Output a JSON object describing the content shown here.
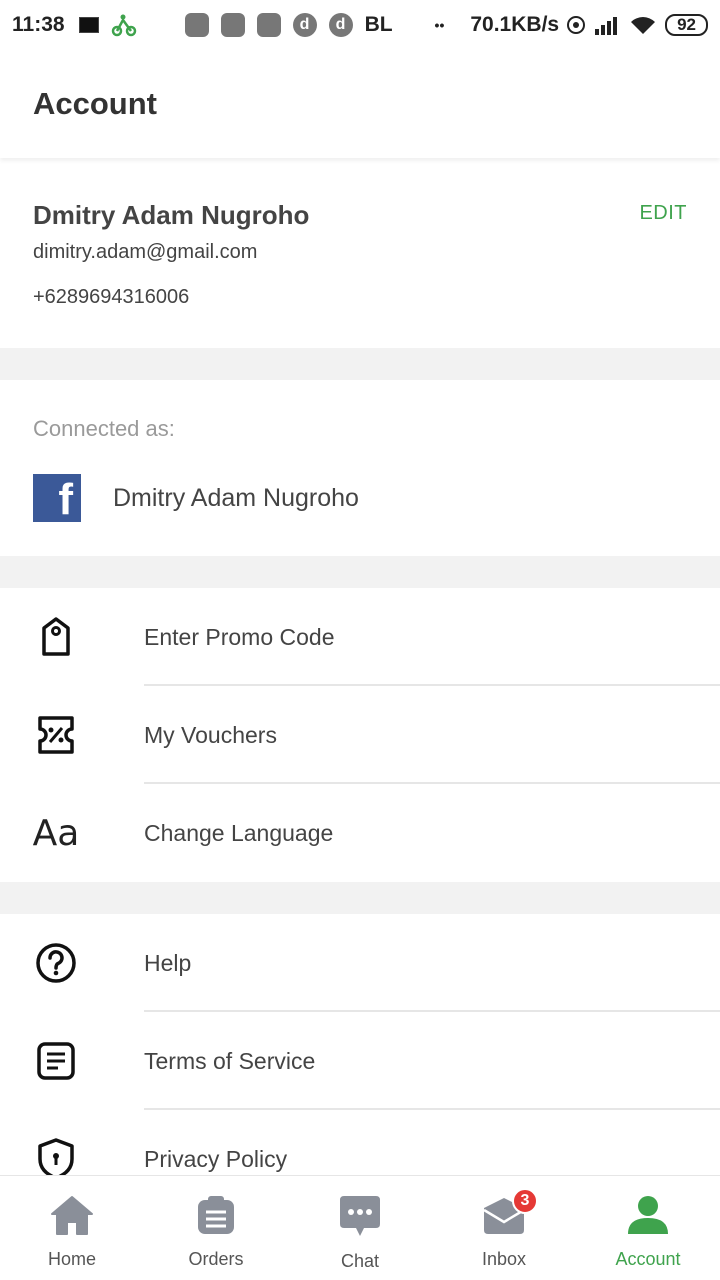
{
  "status": {
    "time": "11:38",
    "carrier_tag": "BL",
    "dots": "••",
    "net_speed": "70.1KB/s",
    "battery": "92"
  },
  "header": {
    "title": "Account"
  },
  "profile": {
    "name": "Dmitry Adam Nugroho",
    "email": "dimitry.adam@gmail.com",
    "phone": "+6289694316006",
    "edit_label": "EDIT"
  },
  "connected": {
    "label": "Connected as:",
    "account_name": "Dmitry Adam Nugroho",
    "provider_glyph": "f"
  },
  "menu_group_1": [
    {
      "label": "Enter Promo Code",
      "icon": "tag-icon"
    },
    {
      "label": "My Vouchers",
      "icon": "voucher-icon"
    },
    {
      "label": "Change Language",
      "icon": "language-icon",
      "glyph": "Aa"
    }
  ],
  "menu_group_2": [
    {
      "label": "Help",
      "icon": "help-icon"
    },
    {
      "label": "Terms of Service",
      "icon": "document-icon"
    },
    {
      "label": "Privacy Policy",
      "icon": "shield-icon"
    }
  ],
  "bottom_nav": [
    {
      "label": "Home",
      "icon": "home-icon"
    },
    {
      "label": "Orders",
      "icon": "orders-icon"
    },
    {
      "label": "Chat",
      "icon": "chat-icon"
    },
    {
      "label": "Inbox",
      "icon": "inbox-icon",
      "badge": "3"
    },
    {
      "label": "Account",
      "icon": "account-icon",
      "active": true
    }
  ],
  "colors": {
    "accent": "#3fa34d",
    "badge": "#e53935",
    "facebook": "#3b5998",
    "nav_icon": "#8a8f99"
  }
}
